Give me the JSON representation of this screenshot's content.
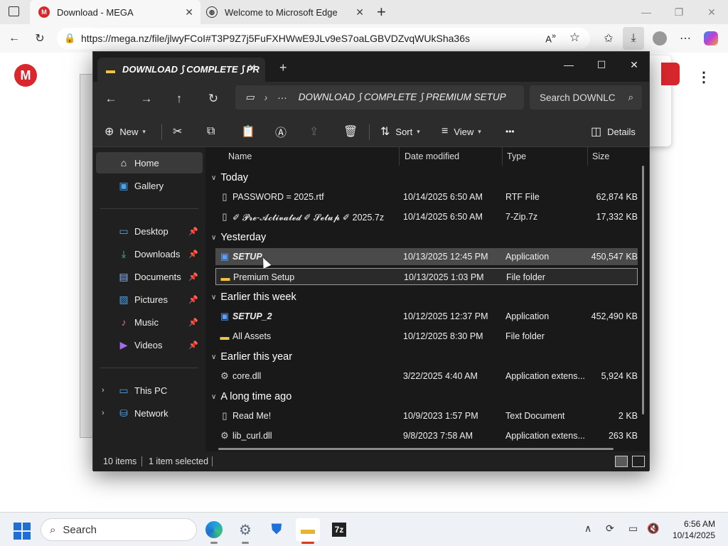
{
  "browser": {
    "tabs": [
      {
        "title": "Download - MEGA",
        "favicon": "mega-icon",
        "active": true
      },
      {
        "title": "Welcome to Microsoft Edge",
        "favicon": "globe-icon",
        "active": false
      }
    ],
    "url": "https://mega.nz/file/jlwyFCoI#T3P9Z7j5FuFXHWwE9JLv9eS7oaLGBVDZvqWUkSha36s",
    "mega_logo": "M"
  },
  "explorer": {
    "tab_title": "DOWNLOAD ⟆ COMPLETE ⟆ PR",
    "breadcrumb_dots": "···",
    "breadcrumb_current": "DOWNLOAD ⟆ COMPLETE ⟆ PREMIUM SETUP",
    "search_placeholder": "Search DOWNLC",
    "commands": {
      "new": "New",
      "sort": "Sort",
      "view": "View",
      "more": "•••",
      "details": "Details"
    },
    "sidebar": {
      "top": [
        {
          "label": "Home",
          "icon": "home-icon",
          "selected": true
        },
        {
          "label": "Gallery",
          "icon": "gallery-icon",
          "selected": false
        }
      ],
      "pinned": [
        {
          "label": "Desktop",
          "icon": "desktop-icon"
        },
        {
          "label": "Downloads",
          "icon": "downloads-icon"
        },
        {
          "label": "Documents",
          "icon": "documents-icon"
        },
        {
          "label": "Pictures",
          "icon": "pictures-icon"
        },
        {
          "label": "Music",
          "icon": "music-icon"
        },
        {
          "label": "Videos",
          "icon": "videos-icon"
        }
      ],
      "drives": [
        {
          "label": "This PC",
          "icon": "pc-icon"
        },
        {
          "label": "Network",
          "icon": "network-icon"
        }
      ]
    },
    "columns": {
      "name": "Name",
      "date": "Date modified",
      "type": "Type",
      "size": "Size"
    },
    "groups": [
      {
        "label": "Today",
        "rows": [
          {
            "name": "PASSWORD =  2025.rtf",
            "date": "10/14/2025 6:50 AM",
            "type": "RTF File",
            "size": "62,874 KB",
            "icon": "document-icon",
            "style": ""
          },
          {
            "name": "✐ 𝓟𝓻𝓮-𝓐𝓬𝓽𝓲𝓿𝓪𝓽𝓮𝓭 ✐ 𝓢𝓮𝓽𝓾𝓹 ✐ 2025.7z",
            "date": "10/14/2025 6:50 AM",
            "type": "7-Zip.7z",
            "size": "17,332 KB",
            "icon": "archive-icon",
            "style": ""
          }
        ]
      },
      {
        "label": "Yesterday",
        "rows": [
          {
            "name": "SETUP",
            "date": "10/13/2025 12:45 PM",
            "type": "Application",
            "size": "450,547 KB",
            "icon": "application-icon",
            "style": "bi",
            "state": "sel"
          },
          {
            "name": "Premium Setup",
            "date": "10/13/2025 1:03 PM",
            "type": "File folder",
            "size": "",
            "icon": "folder-icon",
            "style": "",
            "state": "outline"
          }
        ]
      },
      {
        "label": "Earlier this week",
        "rows": [
          {
            "name": "SETUP_2",
            "date": "10/12/2025 12:37 PM",
            "type": "Application",
            "size": "452,490 KB",
            "icon": "application-icon",
            "style": "bi"
          },
          {
            "name": "All Assets",
            "date": "10/12/2025 8:30 PM",
            "type": "File folder",
            "size": "",
            "icon": "folder-icon",
            "style": ""
          }
        ]
      },
      {
        "label": "Earlier this year",
        "rows": [
          {
            "name": "core.dll",
            "date": "3/22/2025 4:40 AM",
            "type": "Application extens...",
            "size": "5,924 KB",
            "icon": "dll-icon",
            "style": ""
          }
        ]
      },
      {
        "label": "A long time ago",
        "rows": [
          {
            "name": "Read Me!",
            "date": "10/9/2023 1:57 PM",
            "type": "Text Document",
            "size": "2 KB",
            "icon": "document-icon",
            "style": ""
          },
          {
            "name": "lib_curl.dll",
            "date": "9/8/2023 7:58 AM",
            "type": "Application extens...",
            "size": "263 KB",
            "icon": "dll-icon",
            "style": ""
          }
        ]
      }
    ],
    "status": {
      "count": "10 items",
      "selected": "1 item selected"
    }
  },
  "taskbar": {
    "search": "Search",
    "time": "6:56 AM",
    "date": "10/14/2025"
  }
}
